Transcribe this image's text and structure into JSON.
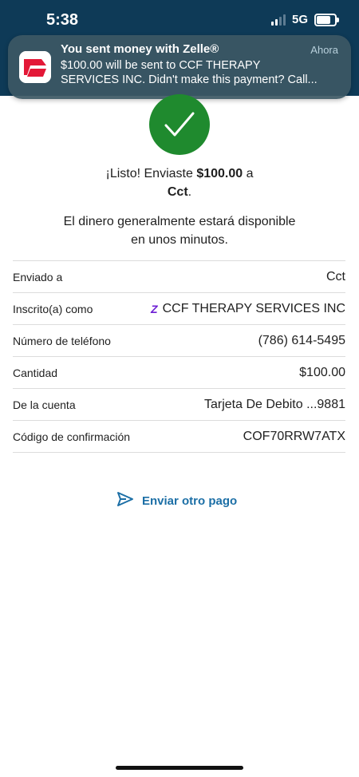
{
  "status_bar": {
    "time": "5:38",
    "network": "5G"
  },
  "notification": {
    "title": "You sent money with Zelle®",
    "time": "Ahora",
    "body_line1": "$100.00 will be sent to CCF THERAPY",
    "body_line2": "SERVICES INC. Didn't make this payment? Call..."
  },
  "confirmation": {
    "headline_prefix": "¡Listo! Enviaste ",
    "amount": "$100.00",
    "headline_mid": " a",
    "recipient": "Cct",
    "headline_end": ".",
    "subline1": "El dinero generalmente estará disponible",
    "subline2": "en unos minutos."
  },
  "details": [
    {
      "label": "Enviado a",
      "value": "Cct"
    },
    {
      "label": "Inscrito(a) como",
      "value": "CCF THERAPY SERVICES INC"
    },
    {
      "label": "Número de teléfono",
      "value": "(786) 614-5495"
    },
    {
      "label": "Cantidad",
      "value": "$100.00"
    },
    {
      "label": "De la cuenta",
      "value": "Tarjeta De Debito ...9881"
    },
    {
      "label": "Código de confirmación",
      "value": "COF70RRW7ATX"
    }
  ],
  "actions": {
    "send_again": "Enviar otro pago"
  },
  "colors": {
    "header": "#0e3a57",
    "success": "#1f8a2e",
    "link": "#1c6fa6",
    "zelle": "#6d1ed4"
  },
  "icons": [
    "zelle-z-icon",
    "checkmark-icon",
    "send-icon",
    "bank-logo-icon"
  ]
}
